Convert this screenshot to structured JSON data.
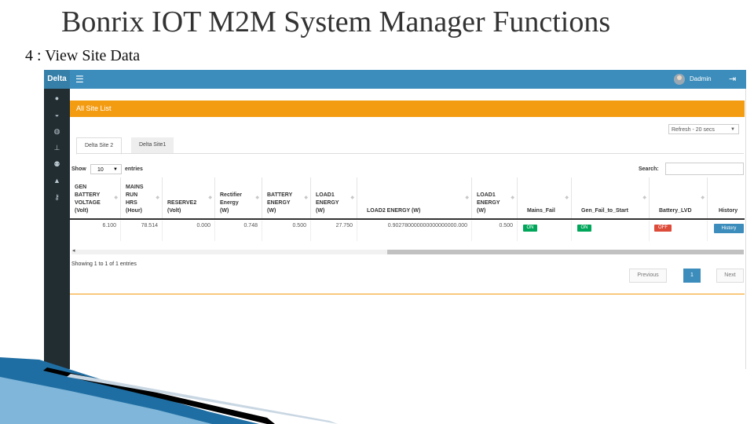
{
  "slide": {
    "title": "Bonrix IOT M2M System Manager Functions",
    "subtitle": "4 : View Site Data"
  },
  "app": {
    "brand": "Delta",
    "user": "Dadmin",
    "menu_icon": "hamburger-icon",
    "logout_icon": "logout-icon"
  },
  "sidebar": {
    "icons": [
      "dashboard-icon",
      "gauge-icon",
      "globe-icon",
      "sitemap-icon",
      "users-icon",
      "bell-icon",
      "key-icon"
    ]
  },
  "panel": {
    "title": "All Site List",
    "refresh": "Refresh - 20 secs",
    "tabs": [
      "Delta Site 2",
      "Delta Site1"
    ],
    "show_label": "Show",
    "show_value": "10",
    "entries_label": "entries",
    "search_label": "Search:",
    "search_value": ""
  },
  "table": {
    "columns": [
      "GEN\nBATTERY\nVOLTAGE\n(Volt)",
      "MAINS\nRUN\nHRS\n(Hour)",
      "RESERVE2\n(Volt)",
      "Rectifier\nEnergy\n(W)",
      "BATTERY\nENERGY\n(W)",
      "LOAD1\nENERGY\n(W)",
      "LOAD2 ENERGY (W)",
      "LOAD1\nENERGY\n(W)",
      "Mains_Fail",
      "Gen_Fail_to_Start",
      "Battery_LVD",
      "History"
    ],
    "row": {
      "gen_battery_voltage": "6.100",
      "mains_run_hrs": "78.514",
      "reserve2": "0.000",
      "rectifier_energy": "0.748",
      "battery_energy": "0.500",
      "load1_energy": "27.750",
      "load2_energy": "0.902780000000000000000.000",
      "load1_energy_2": "0.500",
      "mains_fail": "ON",
      "gen_fail_to_start": "ON",
      "battery_lvd": "OFF",
      "history_button": "History"
    },
    "status_colors": {
      "on": "#00a65a",
      "off": "#dd4b39",
      "button": "#3c8dbc"
    }
  },
  "footer": {
    "info": "Showing 1 to 1 of 1 entries",
    "previous": "Previous",
    "current_page": "1",
    "next": "Next"
  },
  "colors": {
    "topbar": "#3c8dbc",
    "sidebar": "#222d32",
    "panel_header": "#f39c12"
  }
}
